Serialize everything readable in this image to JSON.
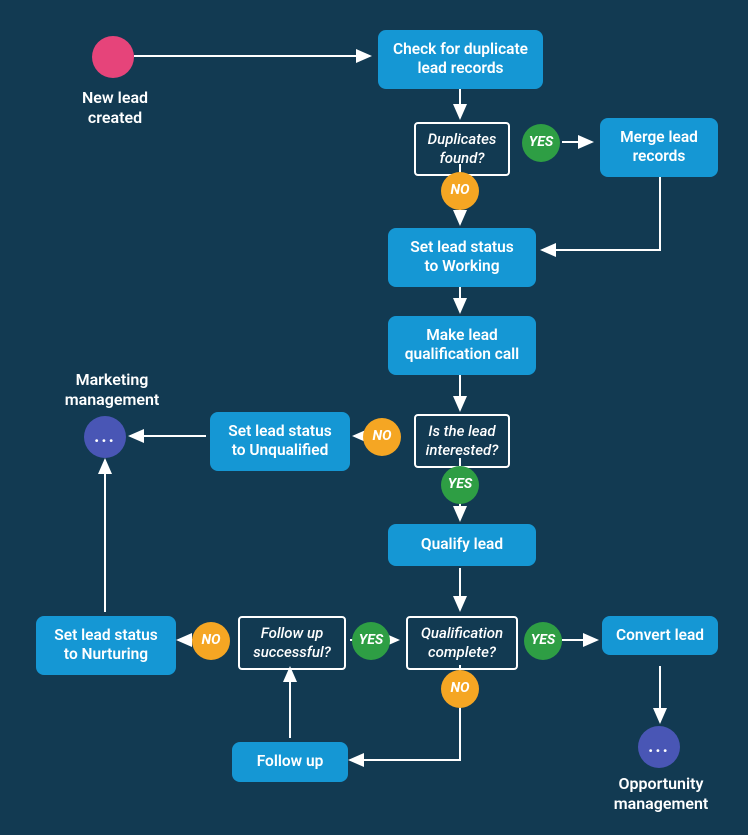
{
  "colors": {
    "background": "#123a52",
    "process": "#1597d4",
    "decision_border": "#ffffff",
    "yes": "#2e9e44",
    "no": "#f5a623",
    "start": "#e6447a",
    "terminal": "#4956b5"
  },
  "nodes": {
    "start_label": "New lead created",
    "check_duplicates": "Check for duplicate lead records",
    "duplicates_found": "Duplicates found?",
    "merge_records": "Merge lead records",
    "set_working": "Set lead status to Working",
    "qual_call": "Make lead qualification call",
    "is_interested": "Is the lead interested?",
    "set_unqualified": "Set lead status to Unqualified",
    "marketing_mgmt": "Marketing management",
    "qualify_lead": "Qualify lead",
    "qual_complete": "Qualification complete?",
    "convert_lead": "Convert lead",
    "opp_mgmt": "Opportunity management",
    "follow_up": "Follow up",
    "follow_success": "Follow up successful?",
    "set_nurturing": "Set lead status to Nurturing",
    "ellipsis": "..."
  },
  "badges": {
    "yes": "YES",
    "no": "NO"
  }
}
